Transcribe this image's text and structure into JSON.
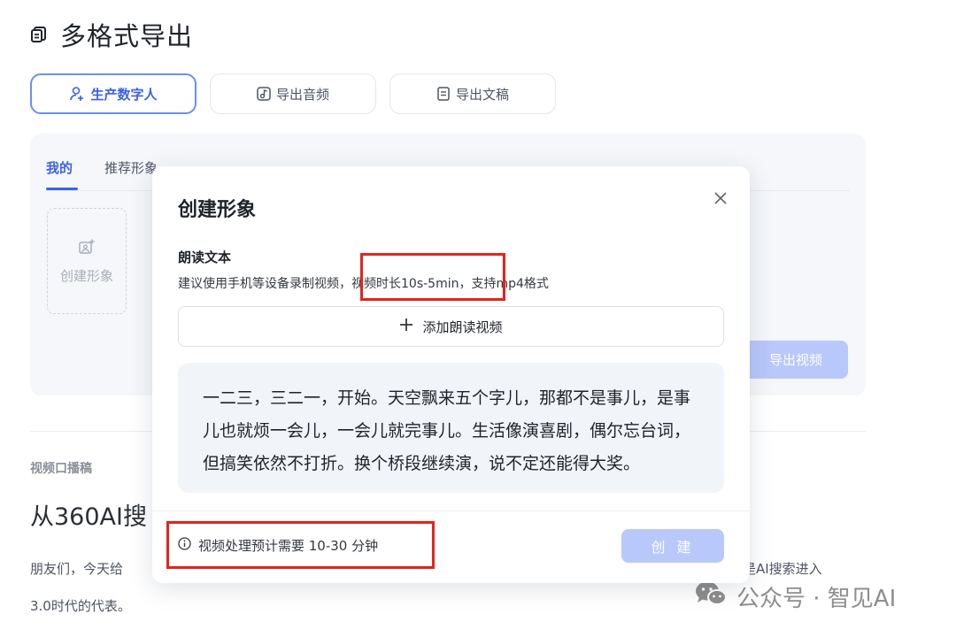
{
  "header": {
    "title": "多格式导出"
  },
  "tabs": [
    {
      "label": "生产数字人",
      "icon": "user-add-icon",
      "active": true
    },
    {
      "label": "导出音频",
      "icon": "music-note-icon",
      "active": false
    },
    {
      "label": "导出文稿",
      "icon": "document-icon",
      "active": false
    }
  ],
  "panel": {
    "sub_tabs": [
      {
        "label": "我的",
        "active": true
      },
      {
        "label": "推荐形象",
        "active": false
      }
    ],
    "create_card_label": "创建形象",
    "export_video_label": "导出视频"
  },
  "article": {
    "section_label": "视频口播稿",
    "headline_visible": "从360AI搜",
    "line1_left": "朋友们，今天给",
    "line1_right": "它是AI搜索进入",
    "line2": "3.0时代的代表。"
  },
  "watermark": "公众号 · 智见AI",
  "modal": {
    "title": "创建形象",
    "section_title": "朗读文本",
    "hint": "建议使用手机等设备录制视频，视频时长10s-5min，支持mp4格式",
    "add_video_label": "添加朗读视频",
    "read_text": "一二三，三二一，开始。天空飘来五个字儿，那都不是事儿，是事儿也就烦一会儿，一会儿就完事儿。生活像演喜剧，偶尔忘台词，但搞笑依然不打折。换个桥段继续演，说不定还能得大奖。",
    "footer_note": "视频处理预计需要 10-30 分钟",
    "create_label": "创 建"
  },
  "colors": {
    "accent": "#3b62e6",
    "disabled_button": "#b8c8fb",
    "annotation": "#e8221b"
  }
}
